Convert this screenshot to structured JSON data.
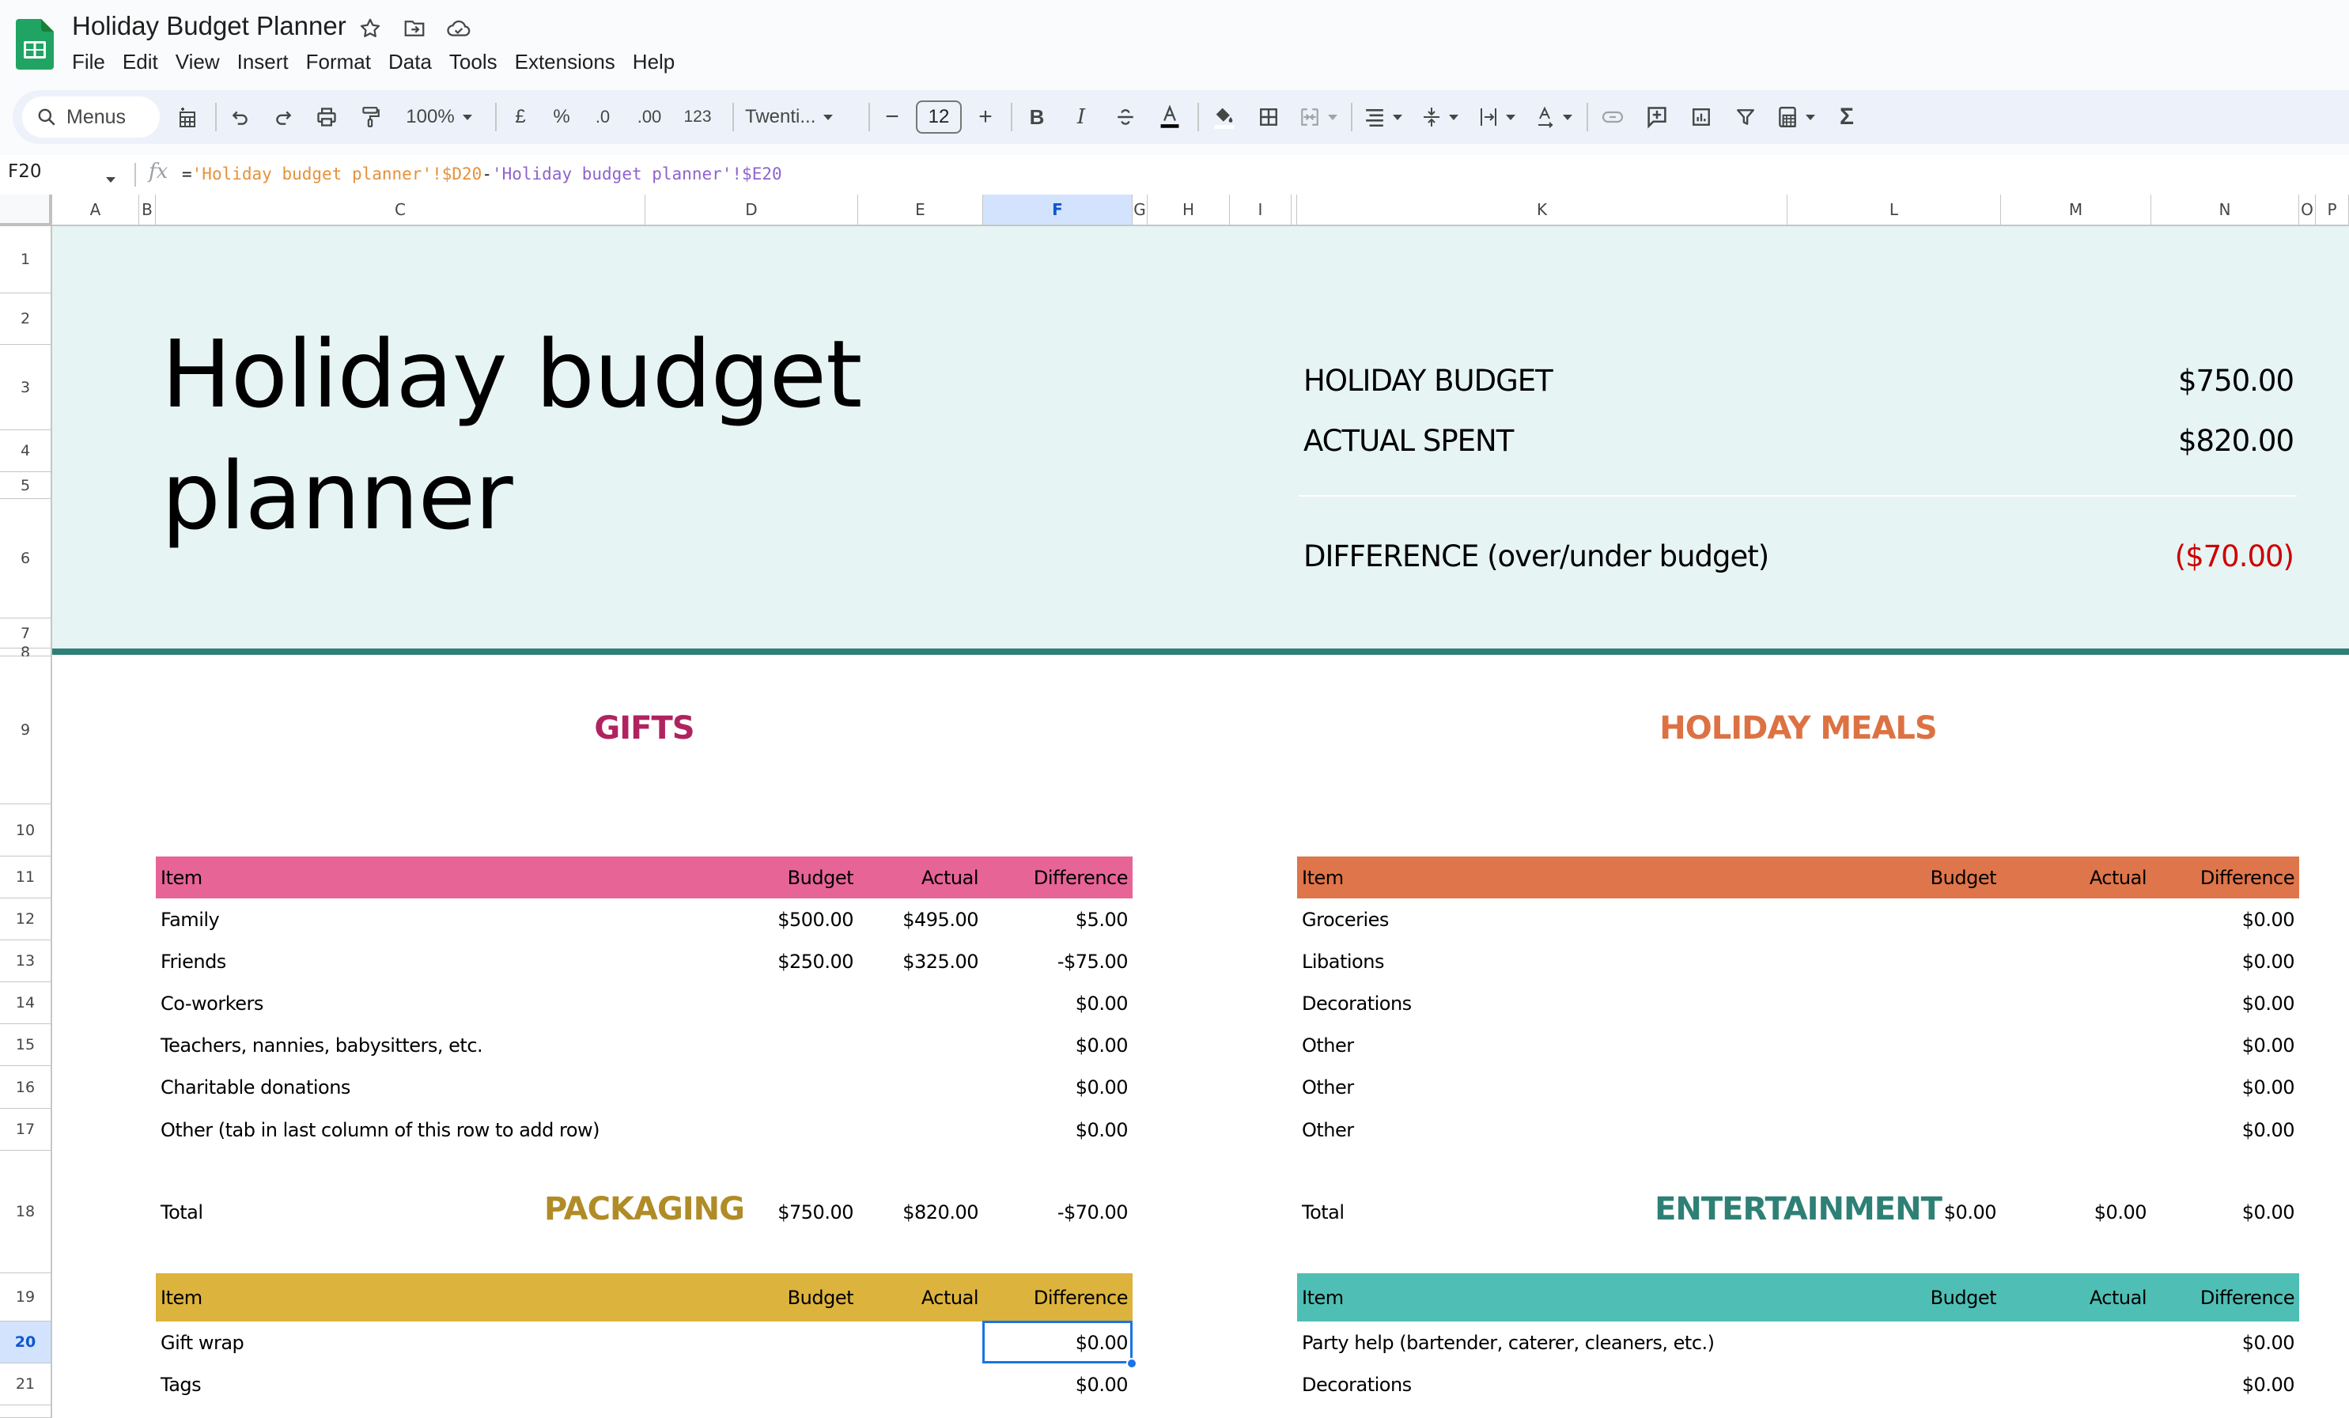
{
  "app": {
    "doc_title": "Holiday Budget Planner",
    "menu": [
      "File",
      "Edit",
      "View",
      "Insert",
      "Format",
      "Data",
      "Tools",
      "Extensions",
      "Help"
    ]
  },
  "toolbar": {
    "search_label": "Menus",
    "zoom": "100%",
    "currency": "£",
    "percent": "%",
    "decrease_decimal": ".0",
    "increase_decimal": ".00",
    "number_format": "123",
    "font": "Twenti...",
    "font_size": "12",
    "bold": "B",
    "italic": "I",
    "sum": "Σ"
  },
  "formula_bar": {
    "cell_ref": "F20",
    "fx": "fx",
    "formula_eq": "=",
    "ref1": "'Holiday budget planner'!$D20",
    "op": "-",
    "ref2": "'Holiday budget planner'!$E20"
  },
  "columns": [
    "A",
    "B",
    "C",
    "D",
    "E",
    "F",
    "G",
    "H",
    "I",
    "K",
    "L",
    "M",
    "N",
    "O",
    "P"
  ],
  "selected_column": "F",
  "rows": [
    "1",
    "2",
    "3",
    "4",
    "5",
    "6",
    "7",
    "8",
    "9",
    "10",
    "11",
    "12",
    "13",
    "14",
    "15",
    "16",
    "17",
    "18",
    "19",
    "20",
    "21",
    ""
  ],
  "selected_row": "20",
  "sheet": {
    "title": "Holiday budget planner",
    "summary": {
      "budget_label": "HOLIDAY BUDGET",
      "budget_value": "$750.00",
      "spent_label": "ACTUAL SPENT",
      "spent_value": "$820.00",
      "diff_label": "DIFFERENCE (over/under budget)",
      "diff_value": "($70.00)",
      "diff_color": "#cc0000"
    },
    "colors": {
      "hero_bg": "#e6f4f3",
      "hero_border": "#2e8076",
      "gifts": "#b0235f",
      "gifts_header": "#e76497",
      "meals": "#dc7243",
      "meals_header": "#df754a",
      "packaging": "#b08c27",
      "packaging_header": "#dcb33c",
      "entertainment": "#2e8076",
      "entertainment_header": "#4fbfb5"
    },
    "headers": {
      "item": "Item",
      "budget": "Budget",
      "actual": "Actual",
      "difference": "Difference"
    },
    "gifts": {
      "title": "GIFTS",
      "rows": [
        {
          "item": "Family",
          "budget": "$500.00",
          "actual": "$495.00",
          "difference": "$5.00"
        },
        {
          "item": "Friends",
          "budget": "$250.00",
          "actual": "$325.00",
          "difference": "-$75.00"
        },
        {
          "item": "Co-workers",
          "budget": "",
          "actual": "",
          "difference": "$0.00"
        },
        {
          "item": "Teachers, nannies, babysitters, etc.",
          "budget": "",
          "actual": "",
          "difference": "$0.00"
        },
        {
          "item": "Charitable donations",
          "budget": "",
          "actual": "",
          "difference": "$0.00"
        },
        {
          "item": "Other (tab in last column of this row to add row)",
          "budget": "",
          "actual": "",
          "difference": "$0.00"
        },
        {
          "item": "Total",
          "budget": "$750.00",
          "actual": "$820.00",
          "difference": "-$70.00"
        }
      ]
    },
    "meals": {
      "title": "HOLIDAY MEALS",
      "rows": [
        {
          "item": "Groceries",
          "budget": "",
          "actual": "",
          "difference": "$0.00"
        },
        {
          "item": "Libations",
          "budget": "",
          "actual": "",
          "difference": "$0.00"
        },
        {
          "item": "Decorations",
          "budget": "",
          "actual": "",
          "difference": "$0.00"
        },
        {
          "item": "Other",
          "budget": "",
          "actual": "",
          "difference": "$0.00"
        },
        {
          "item": "Other",
          "budget": "",
          "actual": "",
          "difference": "$0.00"
        },
        {
          "item": "Other",
          "budget": "",
          "actual": "",
          "difference": "$0.00"
        },
        {
          "item": "Total",
          "budget": "$0.00",
          "actual": "$0.00",
          "difference": "$0.00"
        }
      ]
    },
    "packaging": {
      "title": "PACKAGING",
      "rows": [
        {
          "item": "Gift wrap",
          "budget": "",
          "actual": "",
          "difference": "$0.00"
        },
        {
          "item": "Tags",
          "budget": "",
          "actual": "",
          "difference": "$0.00"
        }
      ]
    },
    "entertainment": {
      "title": "ENTERTAINMENT",
      "rows": [
        {
          "item": "Party help (bartender, caterer, cleaners, etc.)",
          "budget": "",
          "actual": "",
          "difference": "$0.00"
        },
        {
          "item": "Decorations",
          "budget": "",
          "actual": "",
          "difference": "$0.00"
        }
      ]
    }
  }
}
